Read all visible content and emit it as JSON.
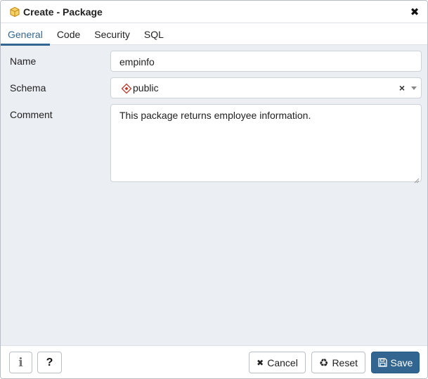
{
  "dialog": {
    "title": "Create - Package",
    "title_icon": "package-icon",
    "close_icon": "close-icon"
  },
  "tabs": [
    {
      "label": "General",
      "active": true
    },
    {
      "label": "Code",
      "active": false
    },
    {
      "label": "Security",
      "active": false
    },
    {
      "label": "SQL",
      "active": false
    }
  ],
  "form": {
    "name": {
      "label": "Name",
      "value": "empinfo"
    },
    "schema": {
      "label": "Schema",
      "value": "public",
      "icon": "schema-icon",
      "clear": "×"
    },
    "comment": {
      "label": "Comment",
      "value": "This package returns employee information."
    }
  },
  "footer": {
    "info_icon": "i",
    "help_icon": "?",
    "cancel_label": "Cancel",
    "reset_label": "Reset",
    "save_label": "Save"
  },
  "colors": {
    "accent": "#326690",
    "panel_bg": "#ebeef3",
    "schema_icon": "#c0392b",
    "package_icon": "#e0a526"
  }
}
